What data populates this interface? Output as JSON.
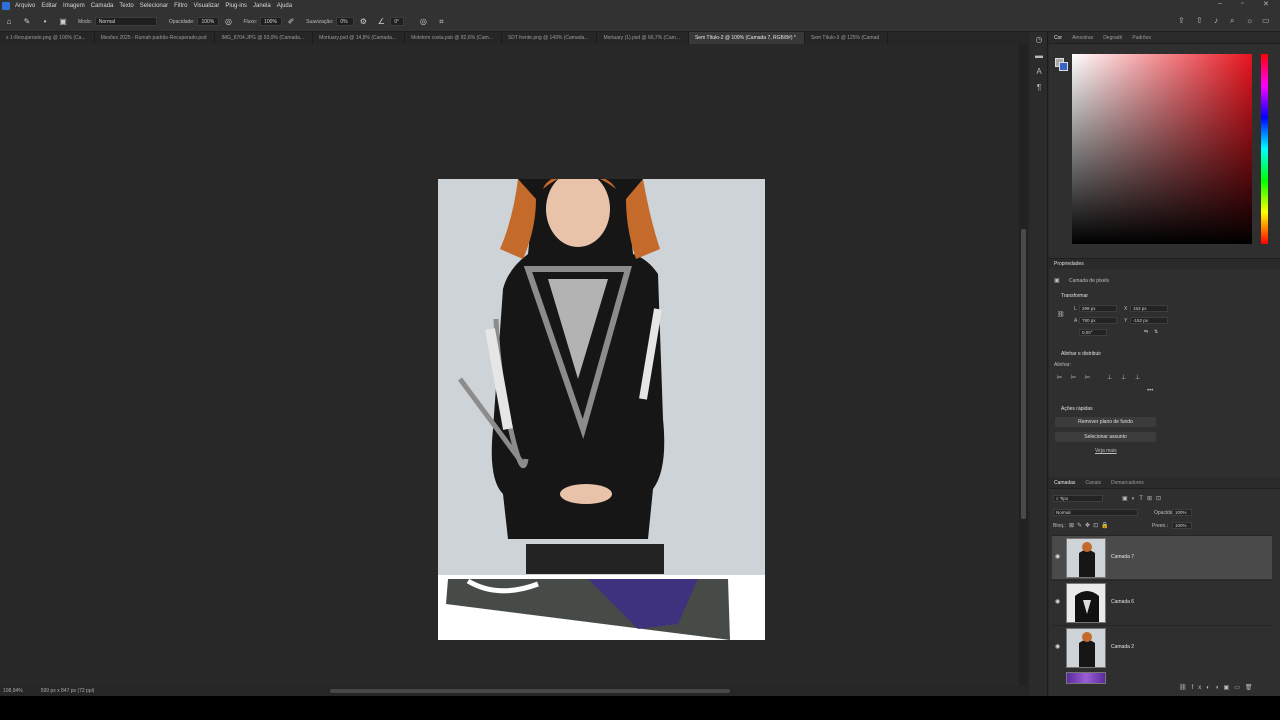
{
  "menu": {
    "items": [
      "Arquivo",
      "Editar",
      "Imagem",
      "Camada",
      "Texto",
      "Selecionar",
      "Filtro",
      "Visualizar",
      "Plug-ins",
      "Janela",
      "Ajuda"
    ]
  },
  "options": {
    "mode_label": "Modo:",
    "mode_value": "Normal",
    "opacity_label": "Opacidade:",
    "opacity_value": "100%",
    "flow_label": "Fluxo:",
    "flow_value": "100%",
    "smoothing_label": "Suavização:",
    "smoothing_value": "0%",
    "angle_value": "0°"
  },
  "tabs": [
    {
      "label": "s 1-Recuperado.png @ 100% (Ca..."
    },
    {
      "label": "Mesões 2025 - Rumah padrão-Recuperado.psd"
    },
    {
      "label": "IMG_8704.JPG @ 93,9% (Camada..."
    },
    {
      "label": "Mortuary.psd @ 14,8% (Camada..."
    },
    {
      "label": "Moletom costa.psb @ 82,6% (Cam..."
    },
    {
      "label": "SDT frente.png @ 149% (Camada..."
    },
    {
      "label": "Mortuary (1).psd @ 66,7% (Cam..."
    },
    {
      "label": "Sem Título-2 @ 109% (Camada 7, RGB/8#) *"
    },
    {
      "label": "Sem Título-3 @ 125% (Camad"
    }
  ],
  "status": {
    "zoom": "108,94%",
    "doc_info": "599 px x 847 px (72 ppi)"
  },
  "color_panel": {
    "tabs": [
      "Cor",
      "Amostras",
      "Degradê",
      "Padrões"
    ]
  },
  "properties": {
    "title": "Propriedades",
    "layer_kind": "Camada de pixels",
    "transform_label": "Transformar",
    "w_label": "L",
    "w_value": "299 px",
    "h_label": "A",
    "h_value": "780 px",
    "x_label": "X",
    "x_value": "153 px",
    "y_label": "Y",
    "y_value": "-152 px",
    "angle_value": "0,00°",
    "align_label": "Alinhar e distribuir",
    "align_sub": "Alinhar:",
    "quick_label": "Ações rápidas",
    "remove_bg": "Remover plano de fundo",
    "select_subject": "Selecionar assunto",
    "more": "Veja mais"
  },
  "layers": {
    "tabs": [
      "Camadas",
      "Canais",
      "Demarcadores"
    ],
    "filter": "Tipo",
    "blend": "Normal",
    "opacity_label": "Opacidade:",
    "opacity_value": "100%",
    "lock_label": "Bloq.:",
    "fill_label": "Preen.:",
    "fill_value": "100%",
    "items": [
      {
        "name": "Camada 7",
        "selected": true
      },
      {
        "name": "Camada 6",
        "selected": false
      },
      {
        "name": "Camada 2",
        "selected": false
      }
    ]
  }
}
